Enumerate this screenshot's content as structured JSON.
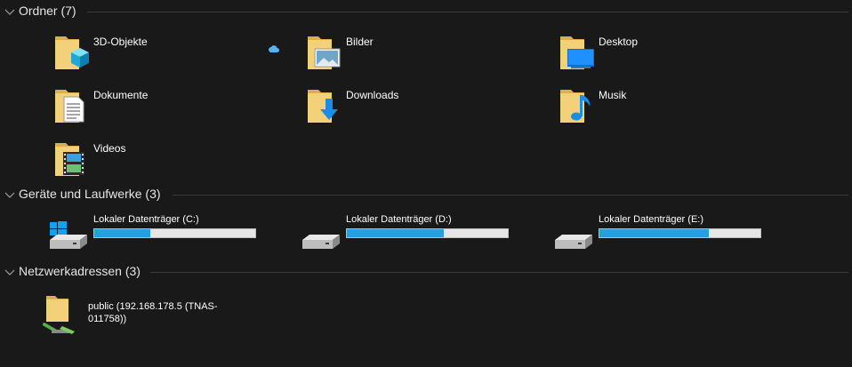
{
  "groups": {
    "folders": {
      "title": "Ordner (7)"
    },
    "drives": {
      "title": "Geräte und Laufwerke (3)"
    },
    "network": {
      "title": "Netzwerkadressen (3)"
    }
  },
  "folders": [
    {
      "label": "3D-Objekte",
      "icon": "3d-objects-folder-icon"
    },
    {
      "label": "Bilder",
      "icon": "pictures-folder-icon",
      "sync_status": "cloud-icon"
    },
    {
      "label": "Desktop",
      "icon": "desktop-folder-icon"
    },
    {
      "label": "Dokumente",
      "icon": "documents-folder-icon"
    },
    {
      "label": "Downloads",
      "icon": "downloads-folder-icon"
    },
    {
      "label": "Musik",
      "icon": "music-folder-icon"
    },
    {
      "label": "Videos",
      "icon": "videos-folder-icon"
    }
  ],
  "drives": [
    {
      "label": "Lokaler Datenträger (C:)",
      "used_fraction": 0.35,
      "icon": "system-drive-icon"
    },
    {
      "label": "Lokaler Datenträger (D:)",
      "used_fraction": 0.6,
      "icon": "hard-drive-icon"
    },
    {
      "label": "Lokaler Datenträger (E:)",
      "used_fraction": 0.68,
      "icon": "hard-drive-icon"
    }
  ],
  "network": [
    {
      "label": "public (192.168.178.5 (TNAS-011758))",
      "icon": "network-folder-icon"
    }
  ],
  "colors": {
    "background": "#191919",
    "accent": "#26a0da",
    "folder": "#e9c46a"
  }
}
